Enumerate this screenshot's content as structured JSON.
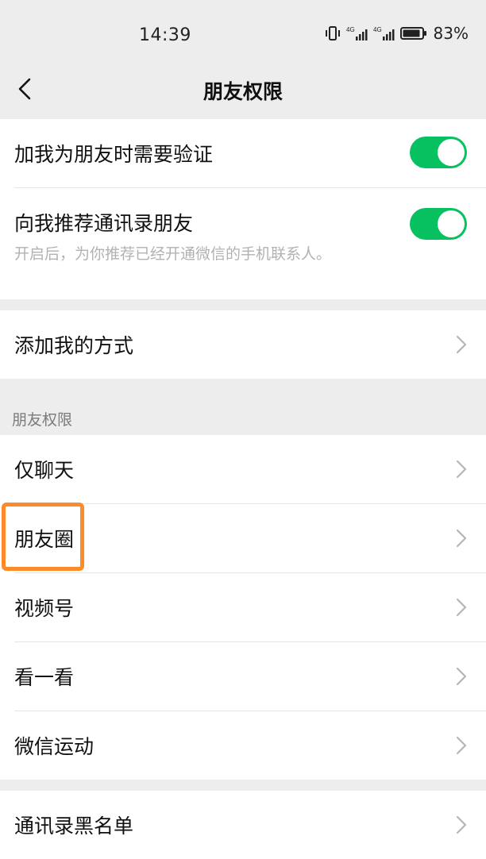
{
  "status_bar": {
    "time": "14:39",
    "battery": "83%",
    "icons": [
      "vibrate-icon",
      "signal-4g-icon",
      "signal-4g-icon",
      "battery-icon"
    ]
  },
  "nav": {
    "title": "朋友权限",
    "back_icon": "chevron-left-icon"
  },
  "verify_group": {
    "items": [
      {
        "label": "加我为朋友时需要验证",
        "toggle": true
      },
      {
        "label": "向我推荐通讯录朋友",
        "toggle": true,
        "description": "开启后，为你推荐已经开通微信的手机联系人。"
      }
    ]
  },
  "add_method": {
    "label": "添加我的方式"
  },
  "permissions_section": {
    "header": "朋友权限",
    "items": [
      {
        "label": "仅聊天"
      },
      {
        "label": "朋友圈"
      },
      {
        "label": "视频号"
      },
      {
        "label": "看一看"
      },
      {
        "label": "微信运动"
      }
    ]
  },
  "blacklist": {
    "label": "通讯录黑名单"
  },
  "colors": {
    "toggle_on": "#07c160",
    "background": "#ededed",
    "highlight": "#ff8a2a"
  }
}
